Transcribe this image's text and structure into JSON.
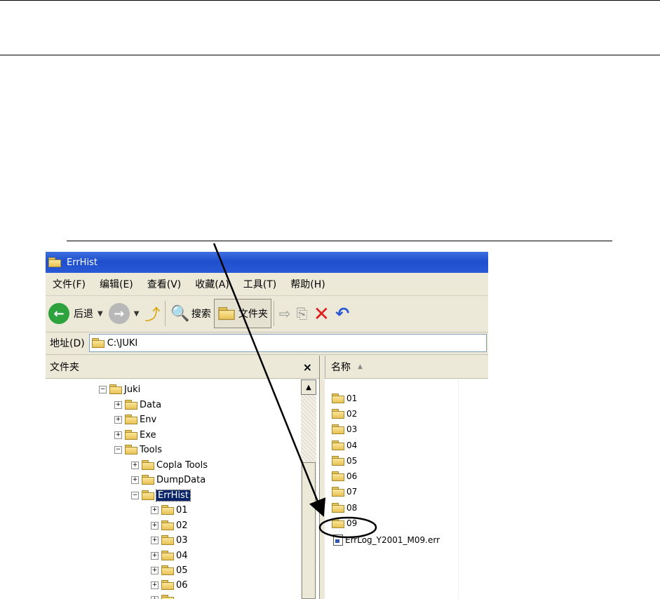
{
  "window": {
    "title": "ErrHist"
  },
  "menu": [
    "文件(F)",
    "编辑(E)",
    "查看(V)",
    "收藏(A)",
    "工具(T)",
    "帮助(H)"
  ],
  "toolbar": {
    "back_label": "后退",
    "search_label": "搜索",
    "folders_label": "文件夹"
  },
  "address": {
    "label": "地址(D)",
    "value": "C:\\JUKI"
  },
  "left_pane": {
    "header": "文件夹",
    "tree": [
      {
        "label": "Juki",
        "toggle": "−"
      },
      {
        "label": "Data",
        "toggle": "+"
      },
      {
        "label": "Env",
        "toggle": "+"
      },
      {
        "label": "Exe",
        "toggle": "+"
      },
      {
        "label": "Tools",
        "toggle": "−"
      },
      {
        "label": "Copla Tools",
        "toggle": "+"
      },
      {
        "label": "DumpData",
        "toggle": "+"
      },
      {
        "label": "ErrHist",
        "toggle": "−"
      },
      {
        "label": "01",
        "toggle": "+"
      },
      {
        "label": "02",
        "toggle": "+"
      },
      {
        "label": "03",
        "toggle": "+"
      },
      {
        "label": "04",
        "toggle": "+"
      },
      {
        "label": "05",
        "toggle": "+"
      },
      {
        "label": "06",
        "toggle": "+"
      }
    ]
  },
  "right_pane": {
    "header": "名称",
    "items": [
      "01",
      "02",
      "03",
      "04",
      "05",
      "06",
      "07",
      "08",
      "09"
    ],
    "file": "ErrLog_Y2001_M09.err"
  },
  "colors": {
    "titlebar": "#2a59d6",
    "selection": "#0a246a",
    "back_button": "#2ea23c",
    "delete_x": "#e02020"
  }
}
